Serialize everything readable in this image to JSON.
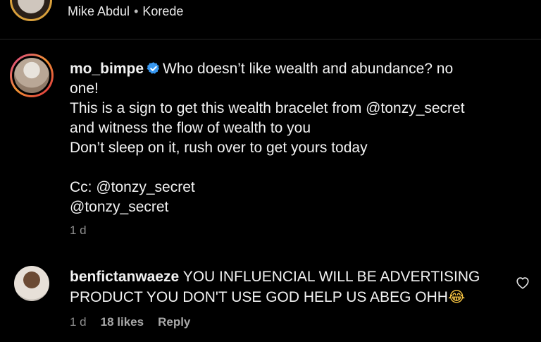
{
  "top_row": {
    "names": [
      "Mike Abdul",
      "Korede"
    ],
    "separator": "•"
  },
  "post": {
    "username": "mo_bimpe",
    "verified": true,
    "lines": [
      "Who doesn’t like wealth and abundance? no",
      "one!",
      "This is a sign to get this wealth bracelet from @tonzy_secret",
      "and witness the flow of wealth to you",
      "Don’t sleep on it, rush over to get yours today",
      "",
      "Cc: @tonzy_secret",
      "@tonzy_secret"
    ],
    "time": "1 d"
  },
  "comment": {
    "username": "benfictanwaeze",
    "line1": "YOU INFLUENCIAL WILL BE ADVERTISING",
    "line2": "PRODUCT YOU DON'T USE GOD HELP US ABEG OHH",
    "emoji": "😂",
    "time": "1 d",
    "likes": "18 likes",
    "reply_label": "Reply"
  },
  "colors": {
    "background": "#000000",
    "text": "#f2f2f2",
    "muted": "#8e8e8e",
    "verified": "#3797f0"
  },
  "icons": [
    "more-icon",
    "verified-badge-icon",
    "heart-icon"
  ]
}
